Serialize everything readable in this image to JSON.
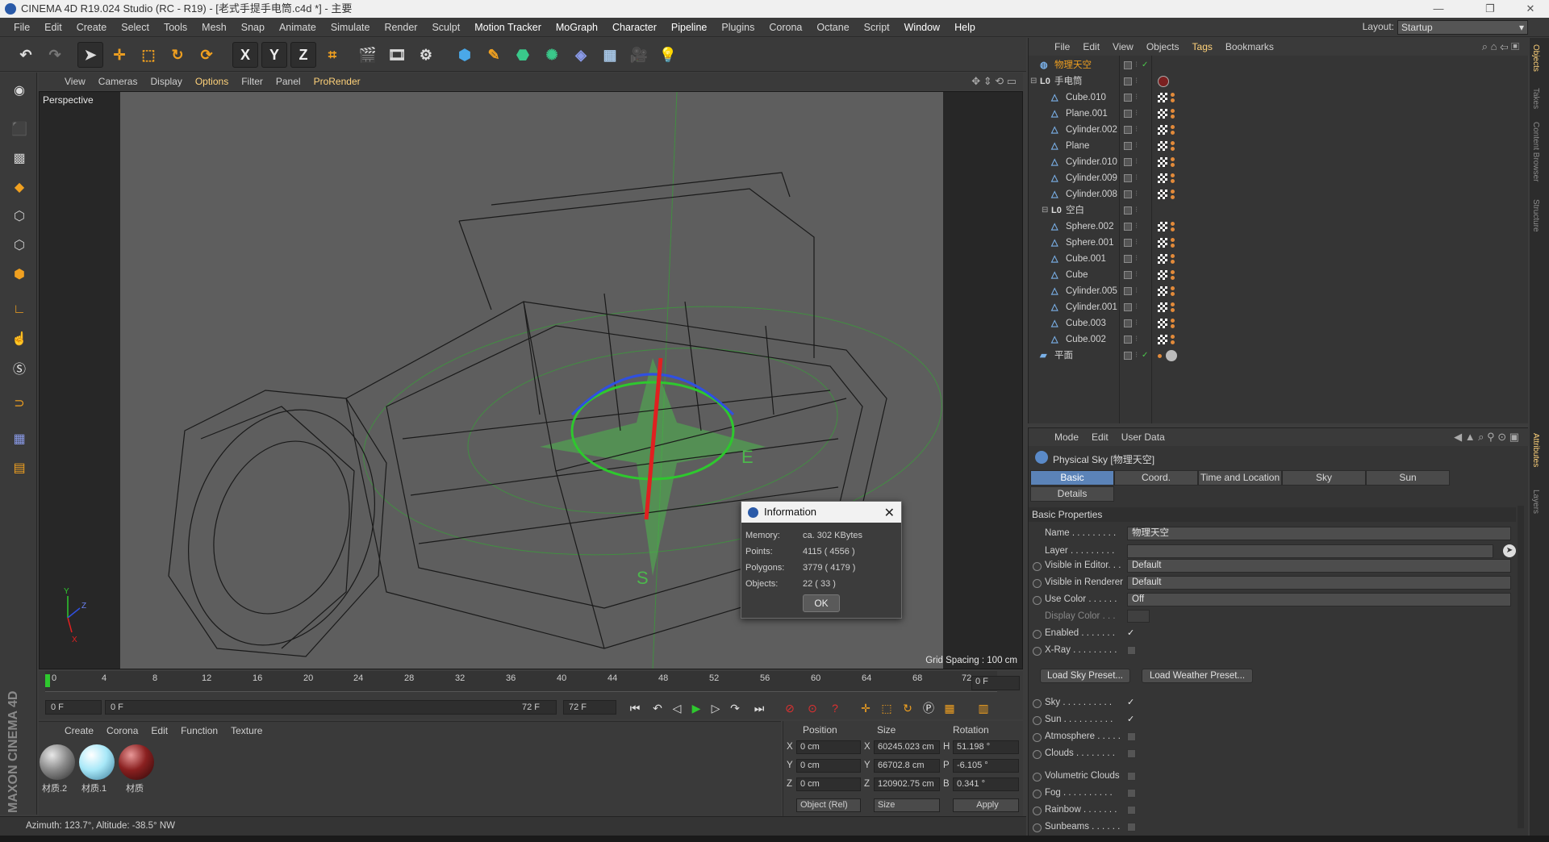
{
  "title": "CINEMA 4D R19.024 Studio (RC - R19) - [老式手提手电筒.c4d *] - 主要",
  "menu": [
    "File",
    "Edit",
    "Create",
    "Select",
    "Tools",
    "Mesh",
    "Snap",
    "Animate",
    "Simulate",
    "Render",
    "Sculpt",
    "Motion Tracker",
    "MoGraph",
    "Character",
    "Pipeline",
    "Plugins",
    "Corona",
    "Octane",
    "Script",
    "Window",
    "Help"
  ],
  "layout": {
    "label": "Layout:",
    "value": "Startup"
  },
  "toolbar_axes": [
    "X",
    "Y",
    "Z"
  ],
  "viewport": {
    "menu": [
      "View",
      "Cameras",
      "Display",
      "Options",
      "Filter",
      "Panel",
      "ProRender"
    ],
    "label": "Perspective",
    "grid_spacing": "Grid Spacing : 100 cm",
    "axis_labels": [
      "Y",
      "Z",
      "X"
    ],
    "compass": [
      "E",
      "S"
    ]
  },
  "info_dialog": {
    "title": "Information",
    "rows": [
      {
        "label": "Memory:",
        "value": "ca. 302 KBytes"
      },
      {
        "label": "Points:",
        "value": "4115 ( 4556 )"
      },
      {
        "label": "Polygons:",
        "value": "3779 ( 4179 )"
      },
      {
        "label": "Objects:",
        "value": "22 ( 33 )"
      }
    ],
    "ok": "OK"
  },
  "timeline": {
    "ticks": [
      "0",
      "4",
      "8",
      "12",
      "16",
      "20",
      "24",
      "28",
      "32",
      "36",
      "40",
      "44",
      "48",
      "52",
      "56",
      "60",
      "64",
      "68",
      "72"
    ],
    "current_frame": "0 F",
    "start": "0 F",
    "range_start": "0 F",
    "range_end": "72 F",
    "end": "72 F"
  },
  "materials": {
    "menu": [
      "Create",
      "Corona",
      "Edit",
      "Function",
      "Texture"
    ],
    "items": [
      {
        "name": "材质.2",
        "color": "#9a9a9a"
      },
      {
        "name": "材质.1",
        "color": "#a8e8f8"
      },
      {
        "name": "材质",
        "color": "#8a2020"
      }
    ]
  },
  "coordinates": {
    "headers": [
      "Position",
      "Size",
      "Rotation"
    ],
    "rows": [
      {
        "axis": "X",
        "pos": "0 cm",
        "size_axis": "X",
        "size": "60245.023 cm",
        "rot_axis": "H",
        "rot": "51.198 °"
      },
      {
        "axis": "Y",
        "pos": "0 cm",
        "size_axis": "Y",
        "size": "66702.8 cm",
        "rot_axis": "P",
        "rot": "-6.105 °"
      },
      {
        "axis": "Z",
        "pos": "0 cm",
        "size_axis": "Z",
        "size": "120902.75 cm",
        "rot_axis": "B",
        "rot": "0.341 °"
      }
    ],
    "mode": "Object (Rel)",
    "size_mode": "Size",
    "apply": "Apply"
  },
  "status": "Azimuth: 123.7°, Altitude: -38.5°  NW",
  "brand": "MAXON CINEMA 4D",
  "objects": {
    "menu": [
      "File",
      "Edit",
      "View",
      "Objects",
      "Tags",
      "Bookmarks"
    ],
    "items": [
      {
        "name": "物理天空",
        "indent": 0,
        "kind": "sky"
      },
      {
        "name": "手电筒",
        "indent": 0,
        "kind": "null"
      },
      {
        "name": "Cube.010",
        "indent": 1,
        "kind": "mesh"
      },
      {
        "name": "Plane.001",
        "indent": 1,
        "kind": "mesh"
      },
      {
        "name": "Cylinder.002",
        "indent": 1,
        "kind": "mesh"
      },
      {
        "name": "Plane",
        "indent": 1,
        "kind": "mesh"
      },
      {
        "name": "Cylinder.010",
        "indent": 1,
        "kind": "mesh"
      },
      {
        "name": "Cylinder.009",
        "indent": 1,
        "kind": "mesh"
      },
      {
        "name": "Cylinder.008",
        "indent": 1,
        "kind": "mesh"
      },
      {
        "name": "空白",
        "indent": 1,
        "kind": "null"
      },
      {
        "name": "Sphere.002",
        "indent": 1,
        "kind": "mesh"
      },
      {
        "name": "Sphere.001",
        "indent": 1,
        "kind": "mesh"
      },
      {
        "name": "Cube.001",
        "indent": 1,
        "kind": "mesh"
      },
      {
        "name": "Cube",
        "indent": 1,
        "kind": "mesh"
      },
      {
        "name": "Cylinder.005",
        "indent": 1,
        "kind": "mesh"
      },
      {
        "name": "Cylinder.001",
        "indent": 1,
        "kind": "mesh"
      },
      {
        "name": "Cube.003",
        "indent": 1,
        "kind": "mesh"
      },
      {
        "name": "Cube.002",
        "indent": 1,
        "kind": "mesh"
      },
      {
        "name": "平面",
        "indent": 0,
        "kind": "floor"
      }
    ]
  },
  "attributes": {
    "menu": [
      "Mode",
      "Edit",
      "User Data"
    ],
    "title": "Physical Sky [物理天空]",
    "tabs": [
      "Basic",
      "Coord.",
      "Time and Location",
      "Sky",
      "Sun",
      "Details"
    ],
    "section": "Basic Properties",
    "name_label": "Name . . . . . . . . .",
    "name_value": "物理天空",
    "layer_label": "Layer . . . . . . . . .",
    "visible_editor_label": "Visible in Editor. . .",
    "visible_editor_value": "Default",
    "visible_renderer_label": "Visible in Renderer",
    "visible_renderer_value": "Default",
    "use_color_label": "Use Color . . . . . .",
    "use_color_value": "Off",
    "display_color_label": "Display Color . . .",
    "enabled_label": "Enabled . . . . . . .",
    "xray_label": "X-Ray . . . . . . . . .",
    "load_sky": "Load Sky Preset...",
    "load_weather": "Load Weather Preset...",
    "sky_label": "Sky . . . . . . . . . .",
    "sun_label": "Sun . . . . . . . . . .",
    "atmosphere_label": "Atmosphere . . . . .",
    "clouds_label": "Clouds . . . . . . . .",
    "volumetric_label": "Volumetric Clouds",
    "fog_label": "Fog . . . . . . . . . .",
    "rainbow_label": "Rainbow . . . . . . .",
    "sunbeams_label": "Sunbeams . . . . . ."
  },
  "right_tabs": [
    "Objects",
    "Takes",
    "Content Browser",
    "Structure",
    "Attributes",
    "Layers"
  ]
}
